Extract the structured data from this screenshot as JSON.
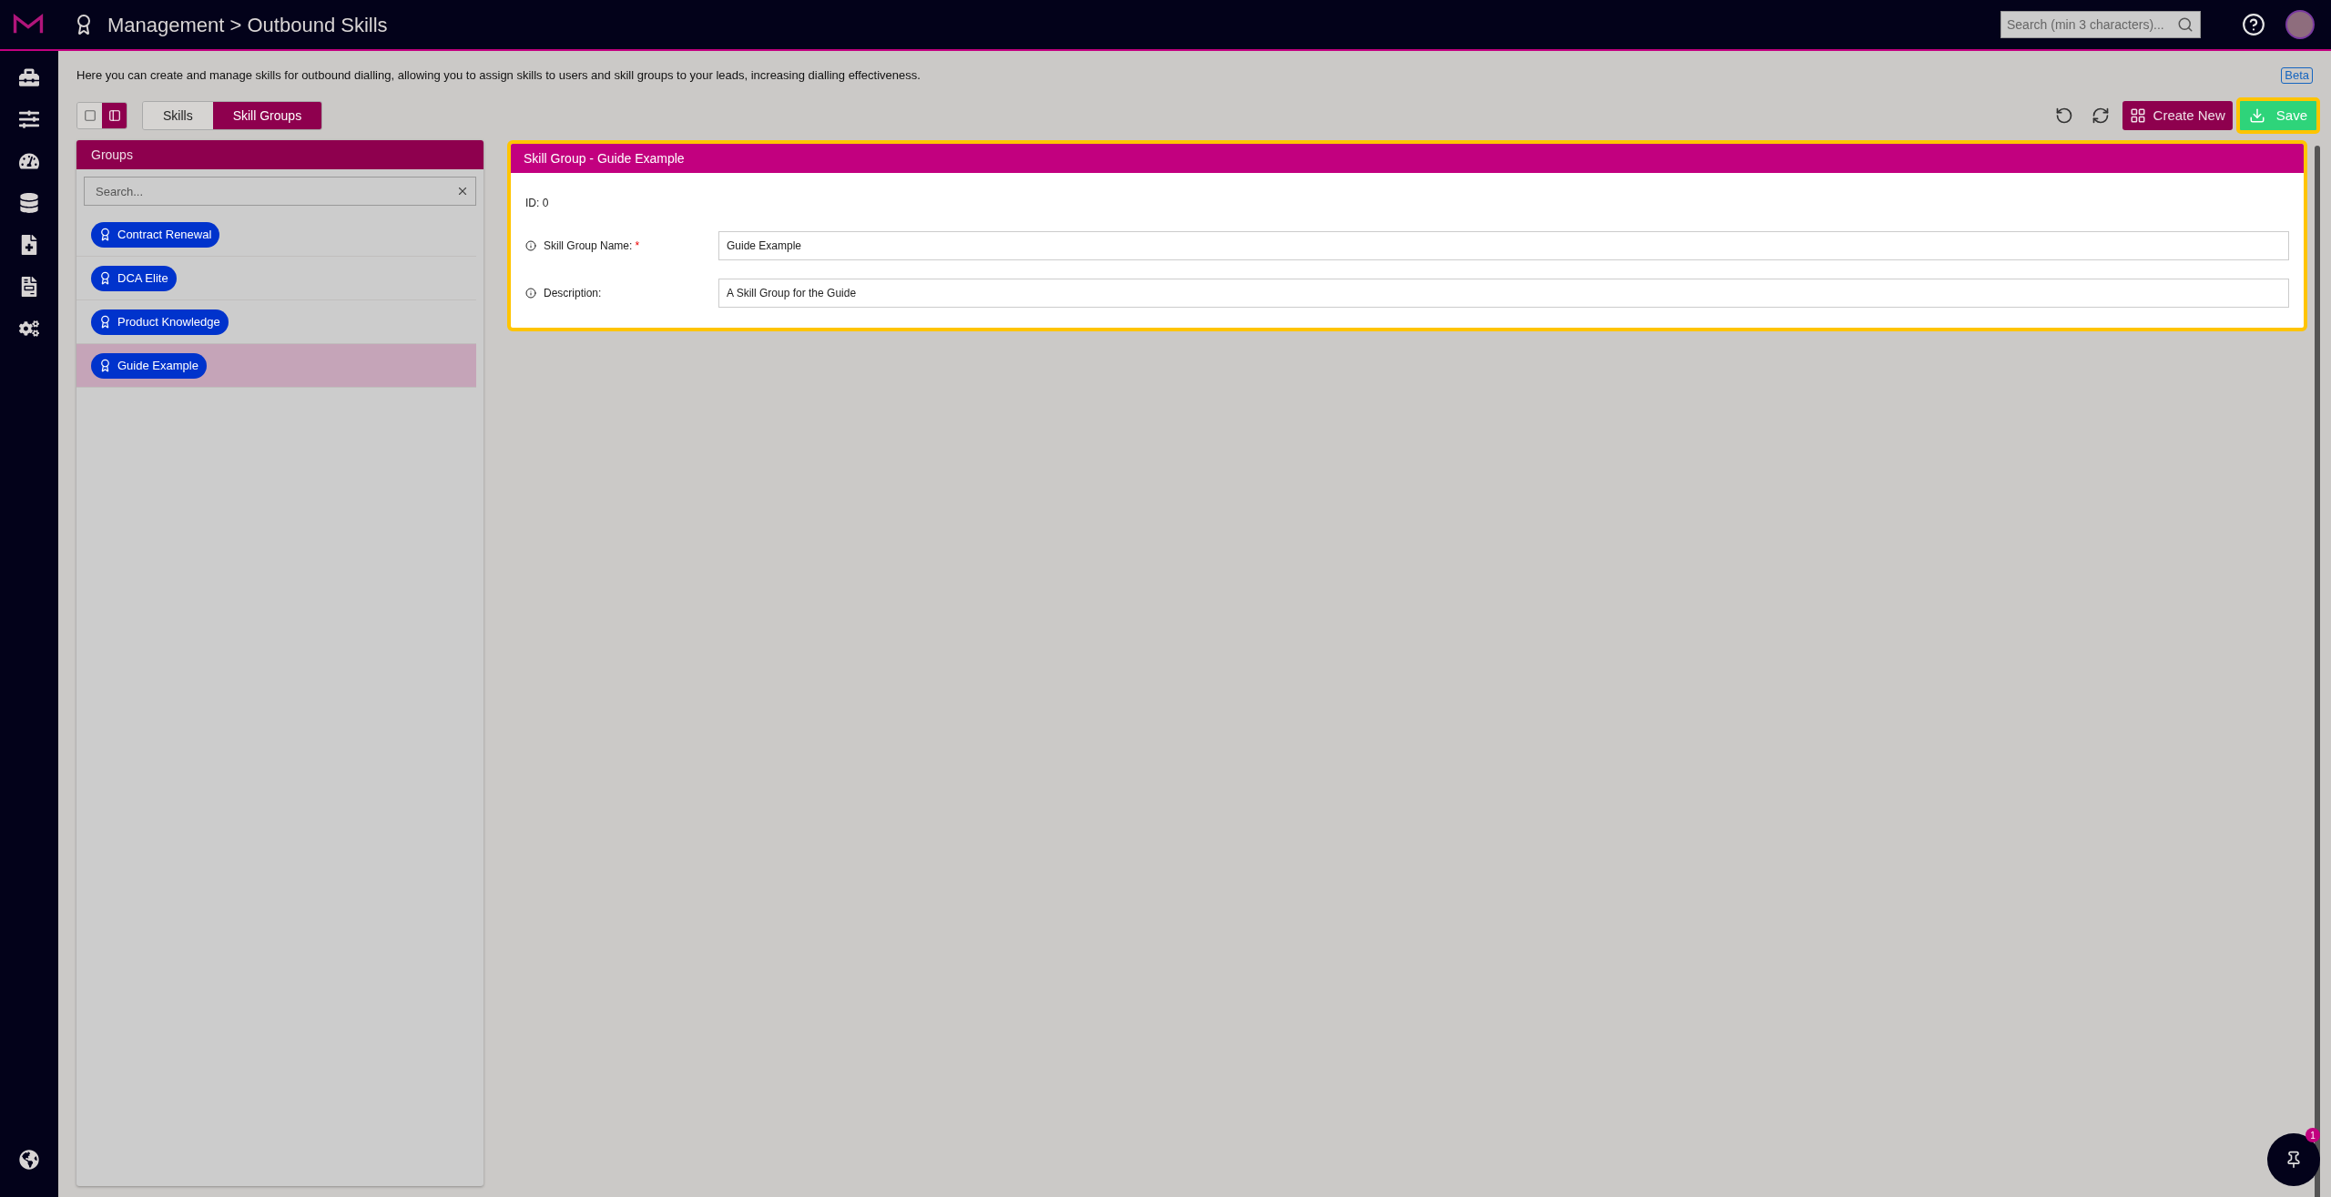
{
  "header": {
    "breadcrumb": "Management > Outbound Skills",
    "search": {
      "placeholder": "Search (min 3 characters)..."
    }
  },
  "intro": "Here you can create and manage skills for outbound dialling, allowing you to assign skills to users and skill groups to your leads, increasing dialling effectiveness.",
  "beta_badge": "Beta",
  "view_toggle": [
    {
      "selected": false
    },
    {
      "selected": true
    }
  ],
  "tabs": [
    {
      "label": "Skills",
      "selected": false
    },
    {
      "label": "Skill Groups",
      "selected": true
    }
  ],
  "toolbar": {
    "create_button": "Create New",
    "save_button": "Save"
  },
  "groups_panel": {
    "title": "Groups",
    "search": {
      "placeholder": "Search..."
    },
    "items": [
      {
        "label": "Contract Renewal",
        "selected": false
      },
      {
        "label": "DCA Elite",
        "selected": false
      },
      {
        "label": "Product Knowledge",
        "selected": false
      },
      {
        "label": "Guide Example",
        "selected": true
      }
    ]
  },
  "form": {
    "title": "Skill Group - Guide Example",
    "id_label": "ID: 0",
    "fields": [
      {
        "label": "Skill Group Name:",
        "required_mark": "*",
        "value": "Guide Example"
      },
      {
        "label": "Description:",
        "value": "A Skill Group for the Guide"
      }
    ]
  },
  "notification_badge": "1"
}
